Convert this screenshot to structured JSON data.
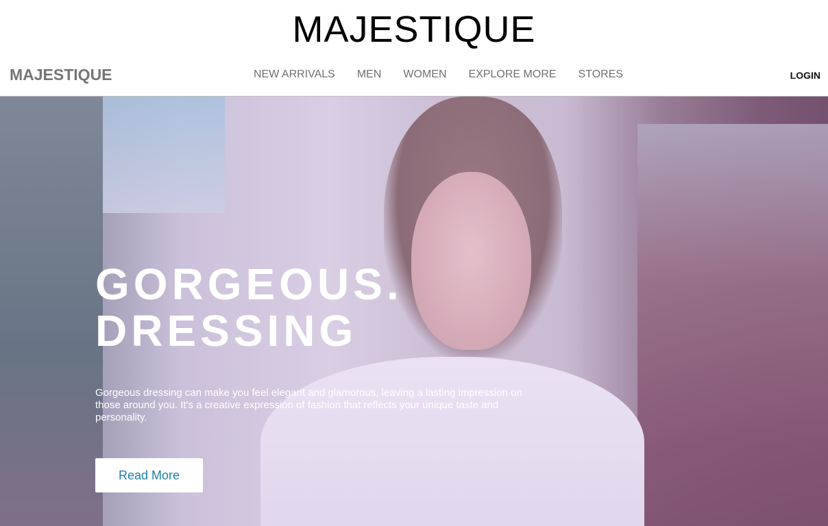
{
  "header": {
    "site_title": "MAJESTIQUE"
  },
  "navbar": {
    "brand": "MAJESTIQUE",
    "links": [
      "NEW ARRIVALS",
      "MEN",
      "WOMEN",
      "EXPLORE MORE",
      "STORES"
    ],
    "login": "LOGIN"
  },
  "hero": {
    "title_line1": "GORGEOUS.",
    "title_line2": "DRESSING",
    "description": "Gorgeous dressing can make you feel elegant and glamorous, leaving a lasting impression on those around you. It's a creative expression of fashion that reflects your unique taste and personality.",
    "button_label": "Read More",
    "image_description_icon": "hero-photo"
  },
  "colors": {
    "button_text": "#1f7ea6",
    "nav_text": "#6f6f6f",
    "brand_text": "#757575"
  }
}
